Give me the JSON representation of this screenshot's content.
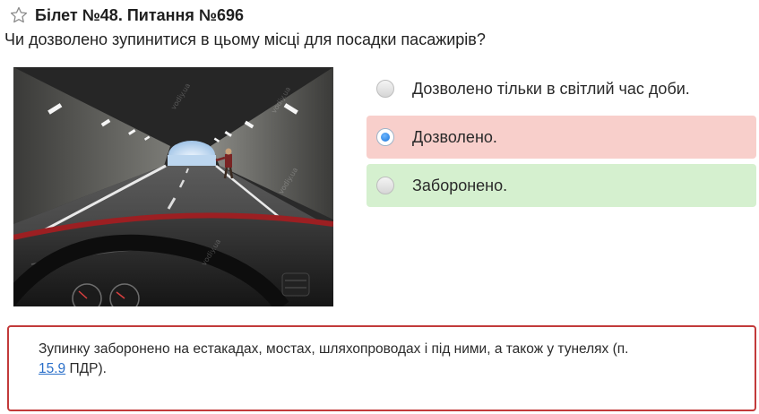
{
  "header": {
    "star_icon": "star-outline-icon",
    "title": "Білет №48. Питання №696"
  },
  "question": "Чи дозволено зупинитися в цьому місці для посадки пасажирів?",
  "image": {
    "watermark": "vodiy.ua"
  },
  "answers": [
    {
      "label": "Дозволено тільки в світлий час доби.",
      "state": "default",
      "selected": false
    },
    {
      "label": "Дозволено.",
      "state": "wrong",
      "selected": true
    },
    {
      "label": "Заборонено.",
      "state": "correct",
      "selected": false
    }
  ],
  "explanation": {
    "text": "Зупинку заборонено на естакадах, мостах, шляхопроводах і під ними, а також у тунелях (п.",
    "link": "15.9",
    "suffix": "ПДР)."
  },
  "colors": {
    "wrong_bg": "#f8cfcb",
    "correct_bg": "#d5f0cf",
    "explanation_border": "#c23a3a",
    "link": "#2a6fc9"
  }
}
